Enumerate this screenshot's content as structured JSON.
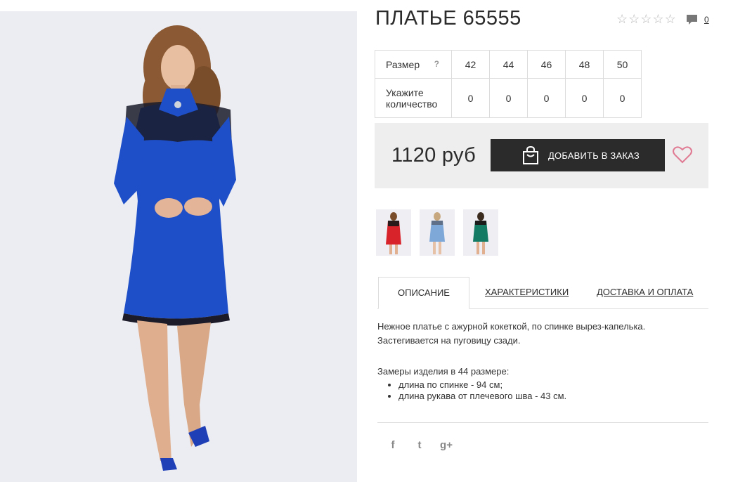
{
  "product": {
    "title": "ПЛАТЬЕ 65555",
    "rating_stars": 5,
    "comments_count": "0"
  },
  "sizes": {
    "size_label": "Размер",
    "help_mark": "?",
    "sizes": [
      "42",
      "44",
      "46",
      "48",
      "50"
    ],
    "qty_label_line1": "Укажите",
    "qty_label_line2": "количество",
    "quantities": [
      "0",
      "0",
      "0",
      "0",
      "0"
    ]
  },
  "buy": {
    "price": "1120 руб",
    "add_label": "ДОБАВИТЬ В ЗАКАЗ"
  },
  "colors": {
    "variants": [
      "red",
      "light-blue",
      "green"
    ],
    "variant_hex": [
      "#d8232a",
      "#7ea8d8",
      "#137a63"
    ],
    "main_dress": "#1e4fc9",
    "accent_heart": "#e07a93",
    "button_bg": "#2b2b2b"
  },
  "tabs": {
    "items": [
      "ОПИСАНИЕ",
      "ХАРАКТЕРИСТИКИ",
      "ДОСТАВКА И ОПЛАТА"
    ],
    "active": 0
  },
  "description": {
    "line1": "Нежное платье с ажурной кокеткой, по спинке вырез-капелька.",
    "line2": "Застегивается на пуговицу сзади.",
    "measure_title": "Замеры изделия в 44 размере:",
    "bullets": [
      "длина по спинке - 94 см;",
      "длина рукава от плечевого шва - 43 см."
    ]
  },
  "social": {
    "icons": [
      "facebook-icon",
      "twitter-icon",
      "google-plus-icon"
    ],
    "glyphs": [
      "f",
      "t",
      "g+"
    ]
  }
}
